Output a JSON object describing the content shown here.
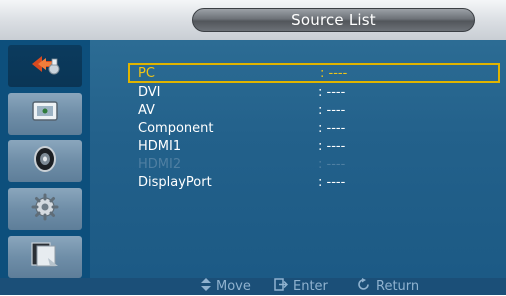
{
  "header": {
    "title": "Source List"
  },
  "sidebar": {
    "items": [
      {
        "icon": "input-icon",
        "active": true
      },
      {
        "icon": "picture-icon",
        "active": false
      },
      {
        "icon": "sound-icon",
        "active": false
      },
      {
        "icon": "setup-icon",
        "active": false
      },
      {
        "icon": "multi-control-icon",
        "active": false
      }
    ]
  },
  "sources": [
    {
      "label": "PC",
      "value": ": ----",
      "state": "selected"
    },
    {
      "label": "DVI",
      "value": ": ----",
      "state": "normal"
    },
    {
      "label": "AV",
      "value": ": ----",
      "state": "normal"
    },
    {
      "label": "Component",
      "value": ": ----",
      "state": "normal"
    },
    {
      "label": "HDMI1",
      "value": ": ----",
      "state": "normal"
    },
    {
      "label": "HDMI2",
      "value": ": ----",
      "state": "disabled"
    },
    {
      "label": "DisplayPort",
      "value": ": ----",
      "state": "normal"
    }
  ],
  "bottombar": {
    "move": {
      "icon": "updown-arrow-icon",
      "label": "Move"
    },
    "enter": {
      "icon": "enter-icon",
      "label": "Enter"
    },
    "return": {
      "icon": "return-icon",
      "label": "Return"
    }
  },
  "colors": {
    "panel": "#1f5e88",
    "sidebar": "#0d4f7c",
    "highlight": "#e0b400",
    "text": "#ffffff",
    "disabled_text": "#4f7fa2"
  }
}
